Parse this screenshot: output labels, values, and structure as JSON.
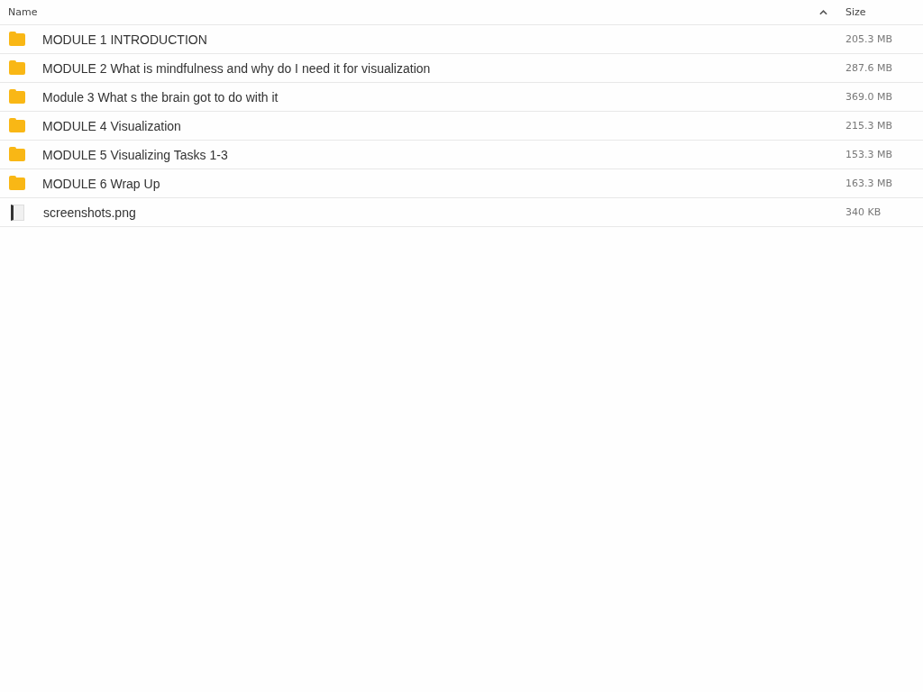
{
  "table": {
    "columns": [
      {
        "label": "Name",
        "sorted": true
      },
      {
        "label": "Size",
        "sorted": false
      }
    ],
    "rows": [
      {
        "kind": "folder",
        "name": "MODULE 1 INTRODUCTION",
        "size": "205.3 MB"
      },
      {
        "kind": "folder",
        "name": "MODULE 2 What is mindfulness and why do I need it for visualization",
        "size": "287.6 MB"
      },
      {
        "kind": "folder",
        "name": "Module 3 What s the brain got to do with it",
        "size": "369.0 MB"
      },
      {
        "kind": "folder",
        "name": "MODULE 4 Visualization",
        "size": "215.3 MB"
      },
      {
        "kind": "folder",
        "name": "MODULE 5 Visualizing Tasks 1-3",
        "size": "153.3 MB"
      },
      {
        "kind": "folder",
        "name": "MODULE 6 Wrap Up",
        "size": "163.3 MB"
      },
      {
        "kind": "file",
        "name": "screenshots.png",
        "size": "340 KB"
      }
    ]
  }
}
